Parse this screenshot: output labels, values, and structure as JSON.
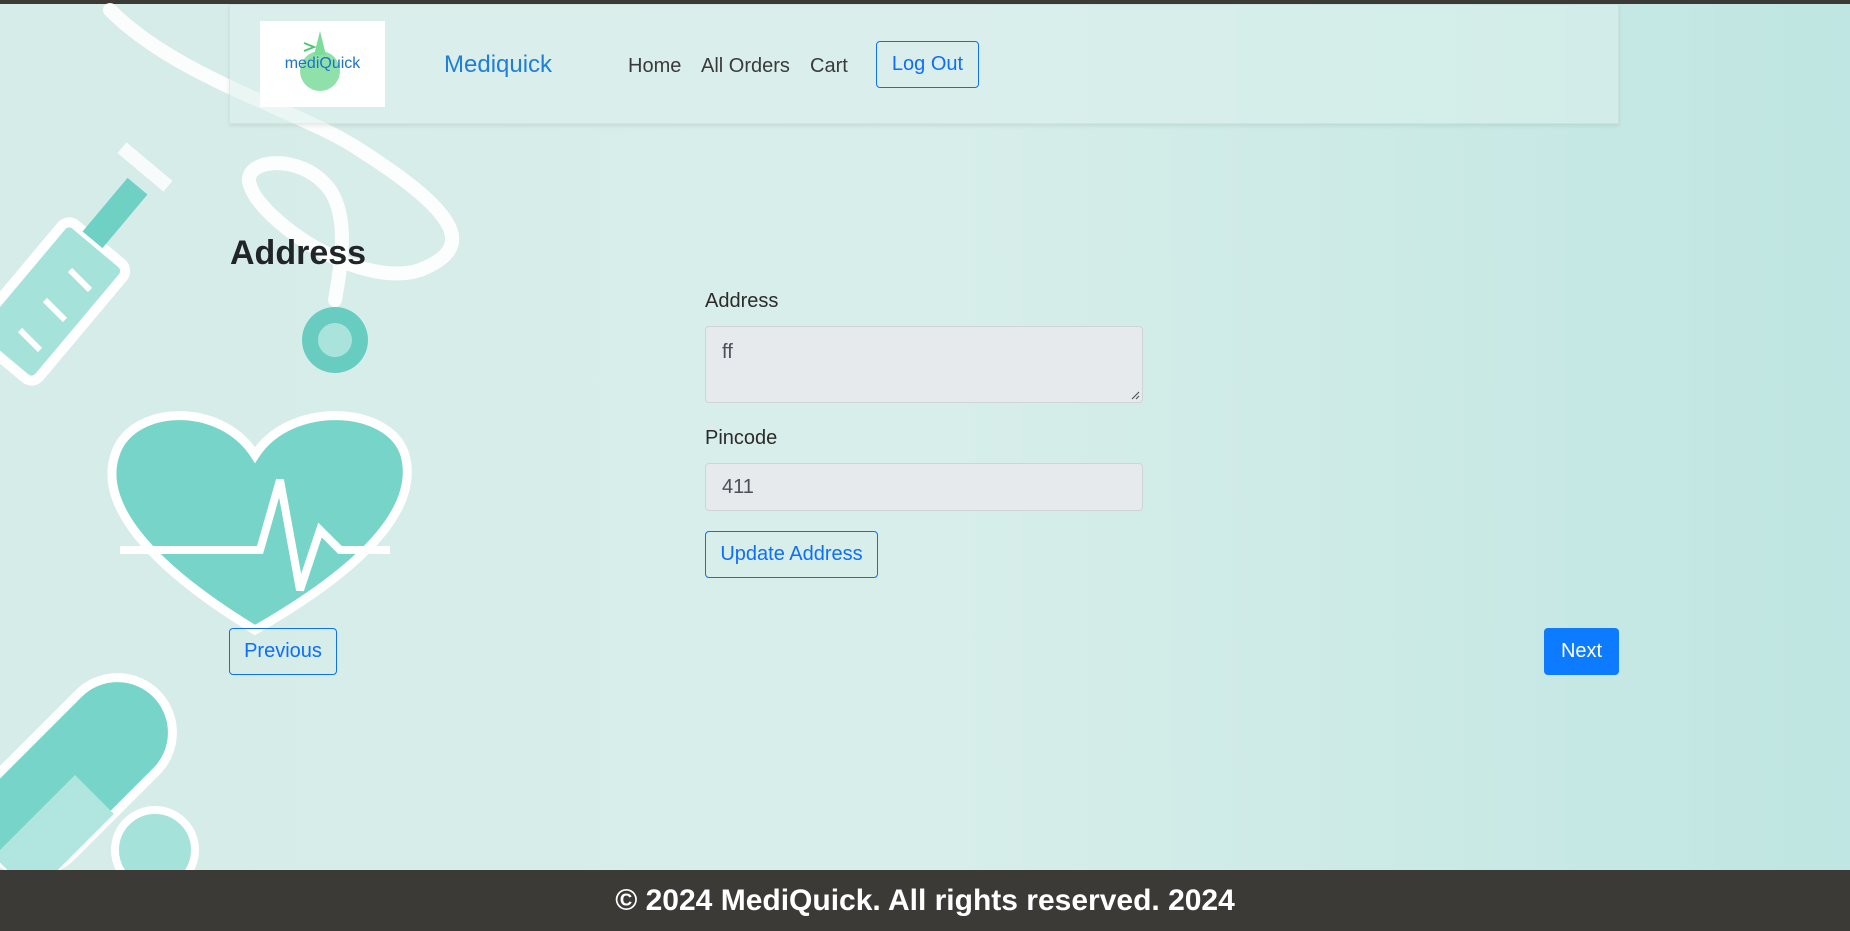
{
  "brand": {
    "logo_text": "mediQuick",
    "name": "Mediquick"
  },
  "nav": {
    "home": "Home",
    "all_orders": "All Orders",
    "cart": "Cart",
    "logout": "Log Out"
  },
  "page": {
    "heading": "Address"
  },
  "form": {
    "address_label": "Address",
    "address_value": "ff",
    "pincode_label": "Pincode",
    "pincode_value": "411",
    "update_button": "Update Address"
  },
  "pagination": {
    "previous": "Previous",
    "next": "Next"
  },
  "footer": {
    "text": "© 2024 MediQuick. All rights reserved. 2024"
  },
  "colors": {
    "accent": "#0d6efd",
    "brand_blue": "#1f7fd8",
    "teal_art": "#76d4c8",
    "footer_bg": "#3b3a37"
  },
  "icons": [
    "medical-background-art",
    "syringe-icon",
    "stethoscope-icon",
    "heart-pulse-icon",
    "pill-icon",
    "logo-gear-icon"
  ]
}
